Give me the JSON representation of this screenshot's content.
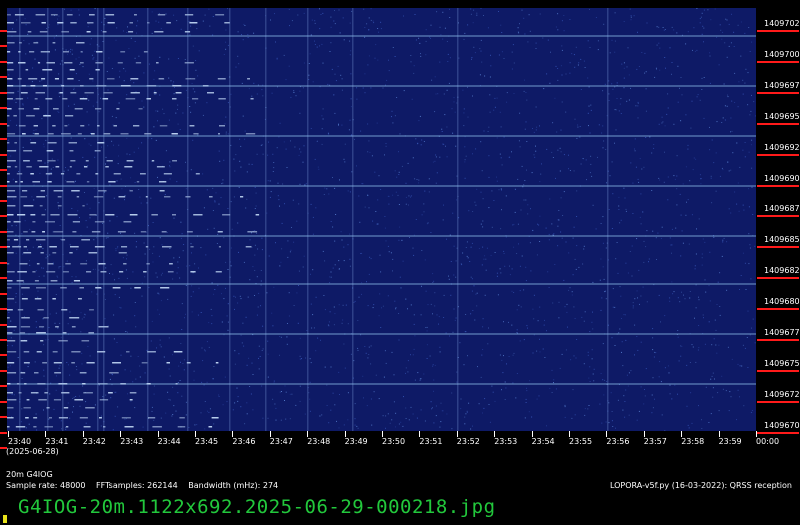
{
  "frequency_labels": [
    "14097025",
    "14097000",
    "14096975",
    "14096950",
    "14096925",
    "14096900",
    "14096875",
    "14096850",
    "14096825",
    "14096800",
    "14096775",
    "14096750",
    "14096725",
    "14096700"
  ],
  "time_labels": [
    "23:40",
    "23:41",
    "23:42",
    "23:43",
    "23:44",
    "23:45",
    "23:46",
    "23:47",
    "23:48",
    "23:49",
    "23:50",
    "23:51",
    "23:52",
    "23:53",
    "23:54",
    "23:55",
    "23:56",
    "23:57",
    "23:58",
    "23:59",
    "00:00"
  ],
  "date": "(2025-06-28)",
  "station": "20m G4IOG",
  "params": {
    "sample_rate": "Sample rate: 48000",
    "fft_samples": "FFTsamples: 262144",
    "bandwidth": "Bandwidth (mHz): 274"
  },
  "software": "LOPORA-v5f.py (16-03-2022): QRSS reception",
  "filename": "G4IOG-20m.1122x692.2025-06-29-000218.jpg",
  "colors": {
    "background": "#0e1a66",
    "trace": "#9fd8ff",
    "tick": "#ff1a1a",
    "filename": "#22c83c"
  }
}
